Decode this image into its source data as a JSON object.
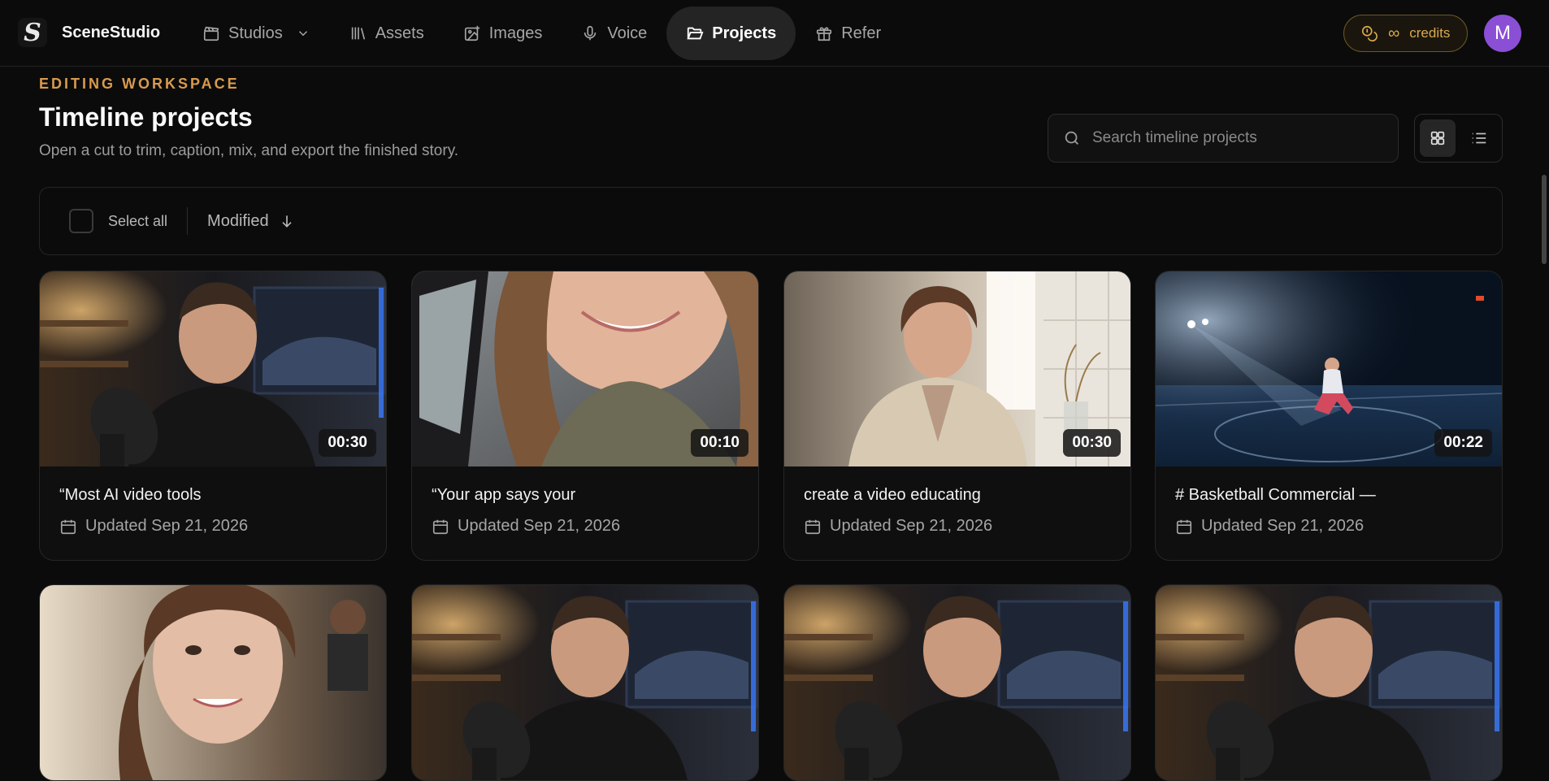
{
  "brand": {
    "name": "SceneStudio",
    "logo_letter": "S"
  },
  "nav": [
    {
      "label": "Studios",
      "icon": "clapperboard-icon",
      "has_dropdown": true,
      "active": false
    },
    {
      "label": "Assets",
      "icon": "library-icon",
      "active": false
    },
    {
      "label": "Images",
      "icon": "image-plus-icon",
      "active": false
    },
    {
      "label": "Voice",
      "icon": "microphone-icon",
      "active": false
    },
    {
      "label": "Projects",
      "icon": "folder-open-icon",
      "active": true
    },
    {
      "label": "Refer",
      "icon": "gift-icon",
      "active": false
    }
  ],
  "credits": {
    "symbol": "∞",
    "label": "credits"
  },
  "user": {
    "initial": "M"
  },
  "header": {
    "eyebrow": "EDITING WORKSPACE",
    "title": "Timeline projects",
    "subtitle": "Open a cut to trim, caption, mix, and export the finished story."
  },
  "search": {
    "placeholder": "Search timeline projects",
    "value": ""
  },
  "view": {
    "mode": "grid"
  },
  "toolbar": {
    "select_all": "Select all",
    "sort_label": "Modified",
    "sort_direction": "descending"
  },
  "projects": [
    {
      "title": "“Most AI video tools",
      "updated": "Updated Sep 21, 2026",
      "duration": "00:30",
      "scene": "creator"
    },
    {
      "title": "“Your app says your",
      "updated": "Updated Sep 21, 2026",
      "duration": "00:10",
      "scene": "car-selfie"
    },
    {
      "title": "create a video educating",
      "updated": "Updated Sep 21, 2026",
      "duration": "00:30",
      "scene": "woman-window"
    },
    {
      "title": "# Basketball Commercial —",
      "updated": "Updated Sep 21, 2026",
      "duration": "00:22",
      "scene": "basketball"
    },
    {
      "title": "",
      "updated": "",
      "duration": "",
      "scene": "woman-gym"
    },
    {
      "title": "",
      "updated": "",
      "duration": "",
      "scene": "creator"
    },
    {
      "title": "",
      "updated": "",
      "duration": "",
      "scene": "creator"
    },
    {
      "title": "",
      "updated": "",
      "duration": "",
      "scene": "creator"
    }
  ],
  "colors": {
    "accent": "#d99a4e",
    "avatar": "#8b4fd6",
    "active_nav": "#242424"
  }
}
